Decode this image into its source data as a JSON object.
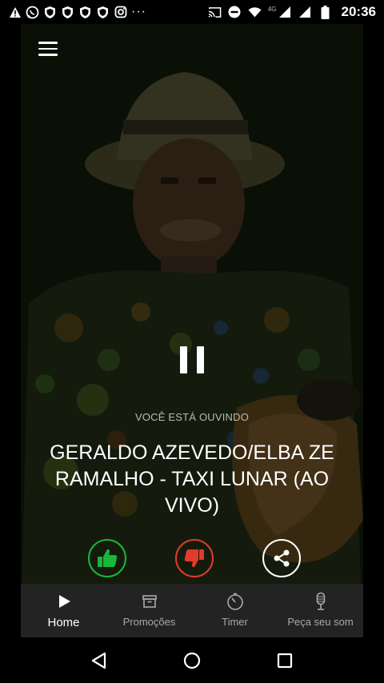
{
  "status_bar": {
    "time": "20:36",
    "network_label": "4G",
    "overflow": "···",
    "icons": [
      "warning-icon",
      "whatsapp-icon",
      "shield-icon",
      "shield-icon",
      "shield-icon",
      "shield-icon",
      "instagram-icon",
      "cast-icon",
      "do-not-disturb-icon",
      "wifi-icon",
      "signal-icon",
      "signal-icon",
      "battery-icon"
    ]
  },
  "player": {
    "now_playing_label": "VOCÊ ESTÁ OUVINDO",
    "song_title": "GERALDO AZEVEDO/ELBA ZE RAMALHO - TAXI LUNAR (AO VIVO)",
    "controls": [
      "pause-icon",
      "thumbs-up-icon",
      "thumbs-down-icon",
      "share-icon"
    ]
  },
  "colors": {
    "like": "#17b83a",
    "dislike": "#e23a2b",
    "nav_background": "#232323",
    "overlay": "#0d1509"
  },
  "bottom_nav": {
    "items": [
      {
        "label": "Home",
        "icon": "play-icon",
        "active": true
      },
      {
        "label": "Promoções",
        "icon": "archive-icon",
        "active": false
      },
      {
        "label": "Timer",
        "icon": "timer-icon",
        "active": false
      },
      {
        "label": "Peça seu som",
        "icon": "microphone-icon",
        "active": false
      }
    ]
  },
  "system_nav": [
    "back-icon",
    "home-icon",
    "recents-icon"
  ]
}
